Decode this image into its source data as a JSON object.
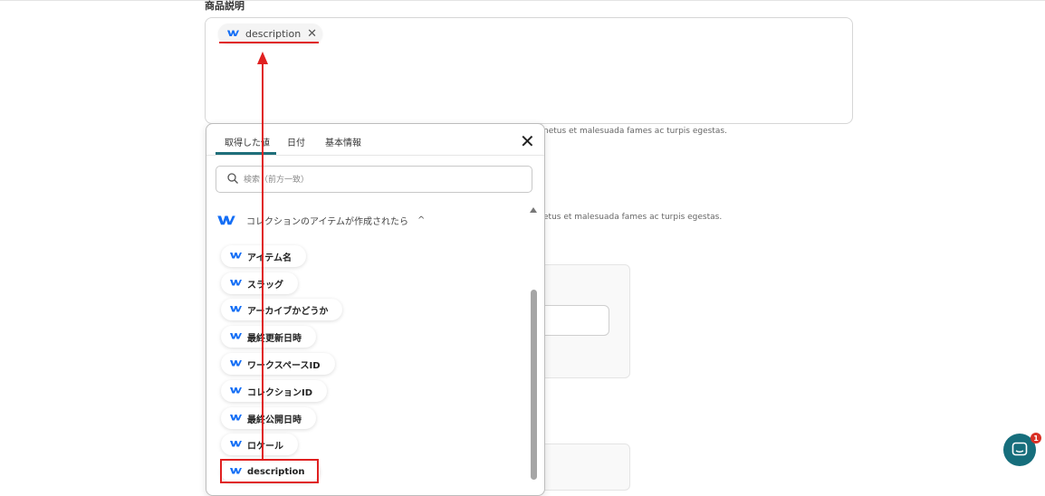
{
  "form": {
    "field_label": "商品説明",
    "tag_chip": {
      "label": "description",
      "icon": "webflow-logo-icon",
      "remove_icon": "close-icon"
    },
    "helper_text_1": "netus et malesuada fames ac turpis egestas.",
    "helper_text_2": "etus et malesuada fames ac turpis egestas."
  },
  "popup": {
    "tabs": [
      {
        "label": "取得した値",
        "active": true
      },
      {
        "label": "日付",
        "active": false
      },
      {
        "label": "基本情報",
        "active": false
      }
    ],
    "close_icon": "close-icon",
    "search": {
      "placeholder": "検索（前方一致）",
      "value": ""
    },
    "group": {
      "title": "コレクションのアイテムが作成されたら",
      "icon": "webflow-logo-icon",
      "expanded": true
    },
    "items": [
      {
        "label": "アイテム名"
      },
      {
        "label": "スラッグ"
      },
      {
        "label": "アーカイブかどうか"
      },
      {
        "label": "最終更新日時"
      },
      {
        "label": "ワークスペースID"
      },
      {
        "label": "コレクションID"
      },
      {
        "label": "最終公開日時"
      },
      {
        "label": "ロケール"
      },
      {
        "label": "description",
        "highlighted": true
      }
    ]
  },
  "help_widget": {
    "icon": "chat-icon",
    "badge_count": "1"
  },
  "colors": {
    "accent": "#1f6f7a",
    "highlight_red": "#e02020",
    "webflow_blue": "#146ef5",
    "help_button": "#166e7c",
    "badge_red": "#d93025"
  }
}
